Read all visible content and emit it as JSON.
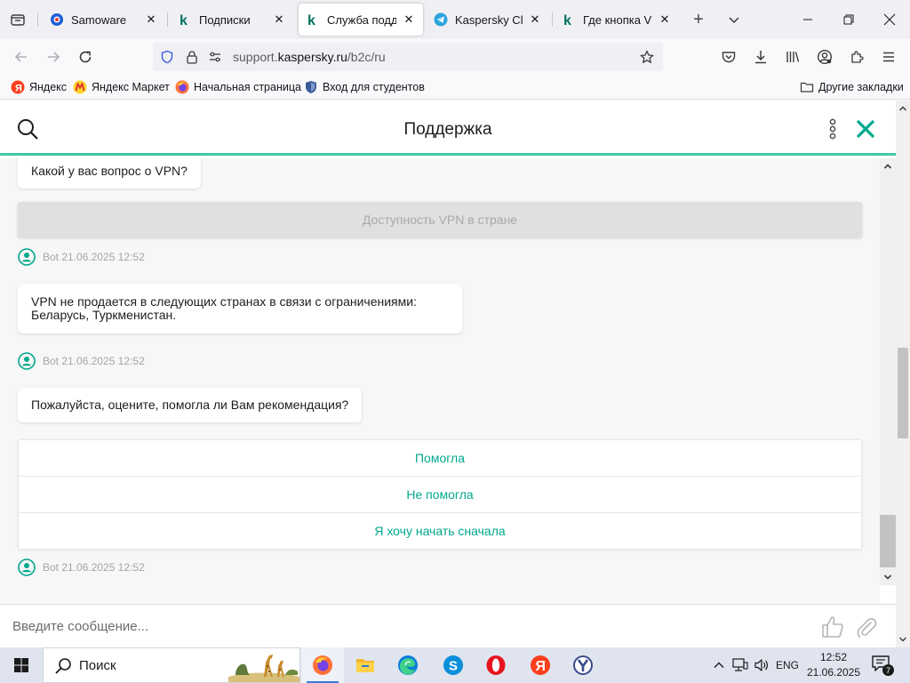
{
  "browser": {
    "tabs": [
      {
        "title": "Samoware",
        "favicon": "samoware-icon"
      },
      {
        "title": "Подписки",
        "favicon": "kaspersky-icon"
      },
      {
        "title": "Служба поддерж",
        "favicon": "kaspersky-icon",
        "active": true
      },
      {
        "title": "Kaspersky Club",
        "favicon": "telegram-icon"
      },
      {
        "title": "Где кнопка VPN",
        "favicon": "kaspersky-icon"
      }
    ],
    "url": {
      "prefix": "support.",
      "domain": "kaspersky.ru",
      "path": "/b2c/ru"
    },
    "bookmarks": [
      {
        "label": "Яндекс",
        "icon": "yandex-icon"
      },
      {
        "label": "Яндекс Маркет",
        "icon": "yandex-market-icon"
      },
      {
        "label": "Начальная страница",
        "icon": "firefox-icon"
      },
      {
        "label": "Вход для студентов",
        "icon": "shield-icon"
      }
    ],
    "other_bookmarks": "Другие закладки"
  },
  "chat": {
    "title": "Поддержка",
    "messages": {
      "q_vpn": "Какой у вас вопрос о VPN?",
      "quick_reply_disabled": "Доступность VPN в стране",
      "meta1": "Bot 21.06.2025 12:52",
      "answer": "VPN не продается в следующих странах в связи с ограничениями: Беларусь, Туркменистан.",
      "meta2": "Bot 21.06.2025 12:52",
      "rate": "Пожалуйста, оцените, помогла ли Вам рекомендация?",
      "meta3": "Bot 21.06.2025 12:52"
    },
    "options": [
      "Помогла",
      "Не помогла",
      "Я хочу начать сначала"
    ],
    "input_placeholder": "Введите сообщение..."
  },
  "taskbar": {
    "search": "Поиск",
    "lang": "ENG",
    "time": "12:52",
    "date": "21.06.2025",
    "notifications": "7"
  },
  "colors": {
    "accent": "#00a88e",
    "header_line": "#3ec8a8",
    "meta_text": "#a5a5a5"
  }
}
